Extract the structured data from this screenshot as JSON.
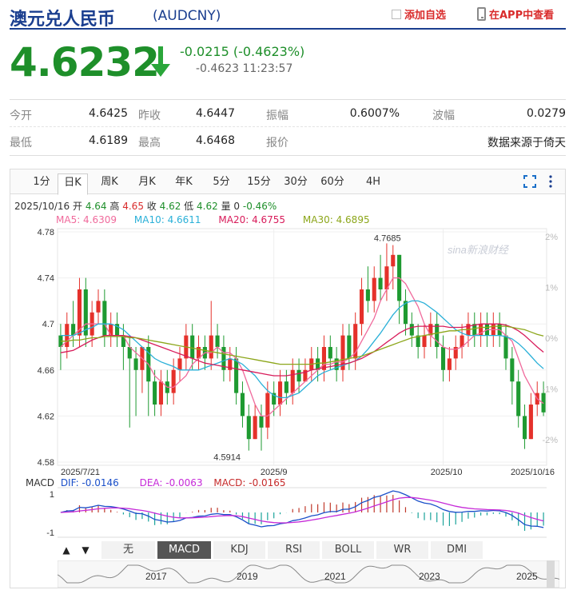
{
  "header": {
    "title": "澳元兑人民币",
    "code": "(AUDCNY)",
    "add_watch": "添加自选",
    "app_view": "在APP中查看"
  },
  "quote": {
    "price": "4.6232",
    "change": "-0.0215 (-0.4623%)",
    "change2": "-0.4623 11:23:57",
    "color_down": "#1e8f2a"
  },
  "stats": [
    {
      "label": "今开",
      "value": "4.6425"
    },
    {
      "label": "昨收",
      "value": "4.6447"
    },
    {
      "label": "振幅",
      "value": "0.6007%"
    },
    {
      "label": "波幅",
      "value": "0.0279"
    },
    {
      "label": "最低",
      "value": "4.6189"
    },
    {
      "label": "最高",
      "value": "4.6468"
    },
    {
      "label": "报价",
      "value": "数据来源于倚天"
    }
  ],
  "period_tabs": [
    "1分",
    "日K",
    "周K",
    "月K",
    "年K",
    "5分",
    "15分",
    "30分",
    "60分",
    "4H"
  ],
  "active_period": "日K",
  "ohlc": {
    "date": "2025/10/16",
    "open_label": "开",
    "open": "4.64",
    "high_label": "高",
    "high": "4.65",
    "close_label": "收",
    "close": "4.62",
    "low_label": "低",
    "low": "4.62",
    "vol_label": "量",
    "vol": "0",
    "pct": "-0.46%"
  },
  "ma": [
    {
      "label": "MA5: 4.6309",
      "color": "#f06a9c"
    },
    {
      "label": "MA10: 4.6611",
      "color": "#2ab0d8"
    },
    {
      "label": "MA20: 4.6755",
      "color": "#d81b5a"
    },
    {
      "label": "MA30: 4.6895",
      "color": "#8ca61a"
    }
  ],
  "macd_legend": {
    "name": "MACD",
    "dif": "DIF: -0.0146",
    "dea": "DEA: -0.0063",
    "macd": "MACD: -0.0165"
  },
  "indicator_tabs": [
    "无",
    "MACD",
    "KDJ",
    "RSI",
    "BOLL",
    "WR",
    "DMI"
  ],
  "active_indicator": "MACD",
  "nav_buttons": [
    "▲",
    "▼"
  ],
  "overview_years": [
    "2017",
    "2019",
    "2021",
    "2023",
    "2025"
  ],
  "watermark": "sina新浪财经",
  "chart_data": {
    "type": "candlestick",
    "y_ticks": [
      "4.78",
      "4.74",
      "4.7",
      "4.66",
      "4.62",
      "4.58"
    ],
    "ylim": [
      4.58,
      4.78
    ],
    "pct_ticks": [
      "2%",
      "1%",
      "0%",
      "-1%",
      "-2%"
    ],
    "x_labels": [
      "2025/7/21",
      "2025/9",
      "2025/10",
      "2025/10/16"
    ],
    "max_label": "4.7685",
    "min_label": "4.5914",
    "macd_ticks": [
      "1",
      "-1"
    ],
    "candles": [
      [
        4.69,
        4.68,
        4.7,
        4.66
      ],
      [
        4.68,
        4.7,
        4.71,
        4.67
      ],
      [
        4.7,
        4.69,
        4.72,
        4.68
      ],
      [
        4.69,
        4.73,
        4.74,
        4.68
      ],
      [
        4.73,
        4.69,
        4.74,
        4.68
      ],
      [
        4.69,
        4.71,
        4.72,
        4.68
      ],
      [
        4.71,
        4.72,
        4.73,
        4.7
      ],
      [
        4.72,
        4.69,
        4.73,
        4.68
      ],
      [
        4.69,
        4.7,
        4.71,
        4.68
      ],
      [
        4.7,
        4.69,
        4.71,
        4.68
      ],
      [
        4.69,
        4.68,
        4.7,
        4.66
      ],
      [
        4.68,
        4.67,
        4.69,
        4.61
      ],
      [
        4.67,
        4.66,
        4.68,
        4.62
      ],
      [
        4.66,
        4.68,
        4.68,
        4.64
      ],
      [
        4.68,
        4.65,
        4.69,
        4.62
      ],
      [
        4.65,
        4.63,
        4.66,
        4.62
      ],
      [
        4.63,
        4.65,
        4.66,
        4.62
      ],
      [
        4.65,
        4.64,
        4.66,
        4.63
      ],
      [
        4.64,
        4.66,
        4.67,
        4.63
      ],
      [
        4.66,
        4.67,
        4.68,
        4.65
      ],
      [
        4.67,
        4.69,
        4.7,
        4.66
      ],
      [
        4.69,
        4.67,
        4.7,
        4.66
      ],
      [
        4.67,
        4.68,
        4.69,
        4.66
      ],
      [
        4.68,
        4.67,
        4.69,
        4.66
      ],
      [
        4.67,
        4.69,
        4.72,
        4.66
      ],
      [
        4.69,
        4.68,
        4.7,
        4.67
      ],
      [
        4.68,
        4.66,
        4.69,
        4.65
      ],
      [
        4.66,
        4.67,
        4.68,
        4.65
      ],
      [
        4.67,
        4.64,
        4.68,
        4.63
      ],
      [
        4.64,
        4.62,
        4.65,
        4.61
      ],
      [
        4.62,
        4.6,
        4.63,
        4.59
      ],
      [
        4.6,
        4.62,
        4.63,
        4.6
      ],
      [
        4.62,
        4.61,
        4.63,
        4.59
      ],
      [
        4.61,
        4.64,
        4.65,
        4.6
      ],
      [
        4.64,
        4.63,
        4.65,
        4.62
      ],
      [
        4.63,
        4.65,
        4.66,
        4.62
      ],
      [
        4.65,
        4.64,
        4.66,
        4.63
      ],
      [
        4.64,
        4.66,
        4.67,
        4.63
      ],
      [
        4.66,
        4.65,
        4.67,
        4.64
      ],
      [
        4.65,
        4.66,
        4.67,
        4.65
      ],
      [
        4.66,
        4.67,
        4.68,
        4.65
      ],
      [
        4.67,
        4.66,
        4.68,
        4.65
      ],
      [
        4.66,
        4.68,
        4.69,
        4.65
      ],
      [
        4.68,
        4.67,
        4.69,
        4.66
      ],
      [
        4.67,
        4.66,
        4.68,
        4.65
      ],
      [
        4.66,
        4.69,
        4.7,
        4.65
      ],
      [
        4.69,
        4.67,
        4.7,
        4.66
      ],
      [
        4.67,
        4.7,
        4.71,
        4.66
      ],
      [
        4.7,
        4.73,
        4.74,
        4.69
      ],
      [
        4.73,
        4.72,
        4.75,
        4.71
      ],
      [
        4.72,
        4.74,
        4.75,
        4.71
      ],
      [
        4.74,
        4.73,
        4.76,
        4.72
      ],
      [
        4.73,
        4.75,
        4.77,
        4.72
      ],
      [
        4.75,
        4.76,
        4.7685,
        4.73
      ],
      [
        4.76,
        4.72,
        4.76,
        4.7
      ],
      [
        4.72,
        4.7,
        4.73,
        4.69
      ],
      [
        4.7,
        4.69,
        4.71,
        4.68
      ],
      [
        4.69,
        4.68,
        4.7,
        4.67
      ],
      [
        4.68,
        4.69,
        4.7,
        4.67
      ],
      [
        4.69,
        4.7,
        4.71,
        4.68
      ],
      [
        4.7,
        4.68,
        4.71,
        4.67
      ],
      [
        4.68,
        4.66,
        4.69,
        4.65
      ],
      [
        4.66,
        4.67,
        4.68,
        4.65
      ],
      [
        4.67,
        4.68,
        4.69,
        4.66
      ],
      [
        4.68,
        4.69,
        4.7,
        4.67
      ],
      [
        4.69,
        4.7,
        4.71,
        4.68
      ],
      [
        4.7,
        4.69,
        4.71,
        4.68
      ],
      [
        4.69,
        4.7,
        4.71,
        4.68
      ],
      [
        4.7,
        4.69,
        4.71,
        4.68
      ],
      [
        4.69,
        4.7,
        4.71,
        4.68
      ],
      [
        4.7,
        4.69,
        4.71,
        4.68
      ],
      [
        4.69,
        4.67,
        4.7,
        4.66
      ],
      [
        4.67,
        4.65,
        4.68,
        4.63
      ],
      [
        4.65,
        4.62,
        4.66,
        4.61
      ],
      [
        4.62,
        4.6,
        4.63,
        4.5914
      ],
      [
        4.6,
        4.63,
        4.64,
        4.6
      ],
      [
        4.63,
        4.64,
        4.65,
        4.62
      ],
      [
        4.64,
        4.6232,
        4.65,
        4.62
      ]
    ],
    "ma5": [
      4.68,
      4.685,
      4.69,
      4.695,
      4.7,
      4.7,
      4.7,
      4.7,
      4.69,
      4.69,
      4.69,
      4.68,
      4.675,
      4.67,
      4.665,
      4.655,
      4.65,
      4.645,
      4.645,
      4.65,
      4.655,
      4.665,
      4.67,
      4.675,
      4.675,
      4.68,
      4.675,
      4.675,
      4.67,
      4.66,
      4.645,
      4.63,
      4.62,
      4.62,
      4.625,
      4.63,
      4.635,
      4.64,
      4.645,
      4.65,
      4.655,
      4.66,
      4.665,
      4.665,
      4.667,
      4.667,
      4.67,
      4.675,
      4.685,
      4.695,
      4.705,
      4.72,
      4.73,
      4.74,
      4.74,
      4.735,
      4.725,
      4.715,
      4.7,
      4.69,
      4.685,
      4.68,
      4.678,
      4.678,
      4.68,
      4.685,
      4.69,
      4.692,
      4.695,
      4.695,
      4.695,
      4.69,
      4.685,
      4.67,
      4.655,
      4.645,
      4.635,
      4.6309
    ],
    "ma10": [
      4.69,
      4.69,
      4.69,
      4.692,
      4.695,
      4.697,
      4.7,
      4.7,
      4.7,
      4.698,
      4.695,
      4.69,
      4.685,
      4.68,
      4.675,
      4.67,
      4.667,
      4.665,
      4.663,
      4.66,
      4.66,
      4.66,
      4.66,
      4.662,
      4.664,
      4.666,
      4.668,
      4.67,
      4.668,
      4.665,
      4.66,
      4.655,
      4.648,
      4.642,
      4.638,
      4.636,
      4.636,
      4.638,
      4.64,
      4.645,
      4.65,
      4.655,
      4.658,
      4.66,
      4.662,
      4.664,
      4.666,
      4.668,
      4.672,
      4.678,
      4.685,
      4.692,
      4.7,
      4.708,
      4.714,
      4.718,
      4.72,
      4.72,
      4.718,
      4.714,
      4.71,
      4.705,
      4.7,
      4.695,
      4.692,
      4.69,
      4.69,
      4.69,
      4.69,
      4.69,
      4.69,
      4.689,
      4.687,
      4.683,
      4.678,
      4.672,
      4.666,
      4.6611
    ],
    "ma20": [
      4.675,
      4.676,
      4.677,
      4.68,
      4.683,
      4.686,
      4.688,
      4.69,
      4.69,
      4.69,
      4.69,
      4.689,
      4.688,
      4.686,
      4.684,
      4.682,
      4.68,
      4.678,
      4.676,
      4.674,
      4.672,
      4.67,
      4.668,
      4.666,
      4.665,
      4.664,
      4.663,
      4.662,
      4.661,
      4.66,
      4.659,
      4.658,
      4.657,
      4.656,
      4.655,
      4.655,
      4.655,
      4.656,
      4.657,
      4.658,
      4.66,
      4.661,
      4.662,
      4.663,
      4.664,
      4.665,
      4.666,
      4.668,
      4.67,
      4.673,
      4.676,
      4.68,
      4.684,
      4.688,
      4.692,
      4.695,
      4.697,
      4.698,
      4.698,
      4.698,
      4.698,
      4.698,
      4.697,
      4.697,
      4.697,
      4.698,
      4.699,
      4.7,
      4.7,
      4.7,
      4.7,
      4.699,
      4.697,
      4.694,
      4.69,
      4.685,
      4.68,
      4.6755
    ],
    "ma30": [
      4.685,
      4.685,
      4.686,
      4.686,
      4.687,
      4.688,
      4.688,
      4.689,
      4.689,
      4.689,
      4.689,
      4.688,
      4.688,
      4.687,
      4.686,
      4.685,
      4.684,
      4.683,
      4.682,
      4.681,
      4.68,
      4.679,
      4.678,
      4.677,
      4.676,
      4.675,
      4.674,
      4.673,
      4.672,
      4.671,
      4.67,
      4.669,
      4.668,
      4.667,
      4.666,
      4.665,
      4.665,
      4.665,
      4.665,
      4.665,
      4.665,
      4.666,
      4.666,
      4.667,
      4.668,
      4.669,
      4.67,
      4.671,
      4.672,
      4.674,
      4.676,
      4.678,
      4.68,
      4.682,
      4.684,
      4.686,
      4.688,
      4.689,
      4.69,
      4.691,
      4.692,
      4.693,
      4.694,
      4.694,
      4.695,
      4.695,
      4.696,
      4.697,
      4.697,
      4.698,
      4.698,
      4.698,
      4.697,
      4.696,
      4.695,
      4.693,
      4.691,
      4.6895
    ]
  }
}
